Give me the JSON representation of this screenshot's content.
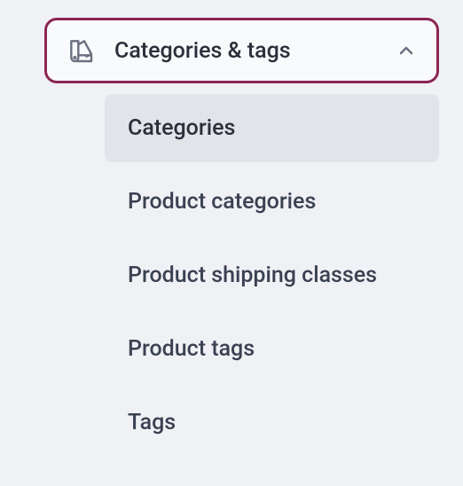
{
  "menu": {
    "header": {
      "label": "Categories & tags",
      "expanded": true
    },
    "items": [
      {
        "label": "Categories",
        "active": true
      },
      {
        "label": "Product categories",
        "active": false
      },
      {
        "label": "Product shipping classes",
        "active": false
      },
      {
        "label": "Product tags",
        "active": false
      },
      {
        "label": "Tags",
        "active": false
      }
    ]
  }
}
